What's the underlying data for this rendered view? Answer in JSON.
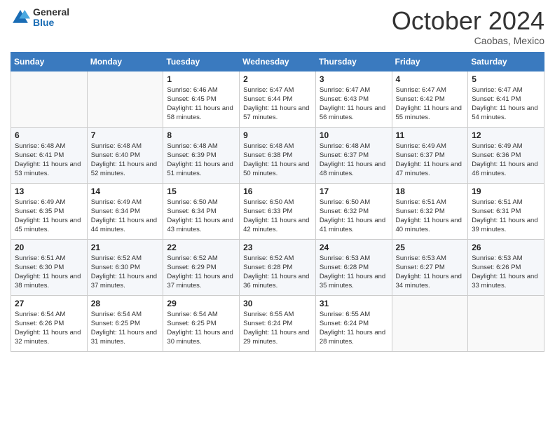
{
  "logo": {
    "general": "General",
    "blue": "Blue"
  },
  "title": "October 2024",
  "location": "Caobas, Mexico",
  "days_header": [
    "Sunday",
    "Monday",
    "Tuesday",
    "Wednesday",
    "Thursday",
    "Friday",
    "Saturday"
  ],
  "weeks": [
    [
      {
        "day": "",
        "content": ""
      },
      {
        "day": "",
        "content": ""
      },
      {
        "day": "1",
        "content": "Sunrise: 6:46 AM\nSunset: 6:45 PM\nDaylight: 11 hours and 58 minutes."
      },
      {
        "day": "2",
        "content": "Sunrise: 6:47 AM\nSunset: 6:44 PM\nDaylight: 11 hours and 57 minutes."
      },
      {
        "day": "3",
        "content": "Sunrise: 6:47 AM\nSunset: 6:43 PM\nDaylight: 11 hours and 56 minutes."
      },
      {
        "day": "4",
        "content": "Sunrise: 6:47 AM\nSunset: 6:42 PM\nDaylight: 11 hours and 55 minutes."
      },
      {
        "day": "5",
        "content": "Sunrise: 6:47 AM\nSunset: 6:41 PM\nDaylight: 11 hours and 54 minutes."
      }
    ],
    [
      {
        "day": "6",
        "content": "Sunrise: 6:48 AM\nSunset: 6:41 PM\nDaylight: 11 hours and 53 minutes."
      },
      {
        "day": "7",
        "content": "Sunrise: 6:48 AM\nSunset: 6:40 PM\nDaylight: 11 hours and 52 minutes."
      },
      {
        "day": "8",
        "content": "Sunrise: 6:48 AM\nSunset: 6:39 PM\nDaylight: 11 hours and 51 minutes."
      },
      {
        "day": "9",
        "content": "Sunrise: 6:48 AM\nSunset: 6:38 PM\nDaylight: 11 hours and 50 minutes."
      },
      {
        "day": "10",
        "content": "Sunrise: 6:48 AM\nSunset: 6:37 PM\nDaylight: 11 hours and 48 minutes."
      },
      {
        "day": "11",
        "content": "Sunrise: 6:49 AM\nSunset: 6:37 PM\nDaylight: 11 hours and 47 minutes."
      },
      {
        "day": "12",
        "content": "Sunrise: 6:49 AM\nSunset: 6:36 PM\nDaylight: 11 hours and 46 minutes."
      }
    ],
    [
      {
        "day": "13",
        "content": "Sunrise: 6:49 AM\nSunset: 6:35 PM\nDaylight: 11 hours and 45 minutes."
      },
      {
        "day": "14",
        "content": "Sunrise: 6:49 AM\nSunset: 6:34 PM\nDaylight: 11 hours and 44 minutes."
      },
      {
        "day": "15",
        "content": "Sunrise: 6:50 AM\nSunset: 6:34 PM\nDaylight: 11 hours and 43 minutes."
      },
      {
        "day": "16",
        "content": "Sunrise: 6:50 AM\nSunset: 6:33 PM\nDaylight: 11 hours and 42 minutes."
      },
      {
        "day": "17",
        "content": "Sunrise: 6:50 AM\nSunset: 6:32 PM\nDaylight: 11 hours and 41 minutes."
      },
      {
        "day": "18",
        "content": "Sunrise: 6:51 AM\nSunset: 6:32 PM\nDaylight: 11 hours and 40 minutes."
      },
      {
        "day": "19",
        "content": "Sunrise: 6:51 AM\nSunset: 6:31 PM\nDaylight: 11 hours and 39 minutes."
      }
    ],
    [
      {
        "day": "20",
        "content": "Sunrise: 6:51 AM\nSunset: 6:30 PM\nDaylight: 11 hours and 38 minutes."
      },
      {
        "day": "21",
        "content": "Sunrise: 6:52 AM\nSunset: 6:30 PM\nDaylight: 11 hours and 37 minutes."
      },
      {
        "day": "22",
        "content": "Sunrise: 6:52 AM\nSunset: 6:29 PM\nDaylight: 11 hours and 37 minutes."
      },
      {
        "day": "23",
        "content": "Sunrise: 6:52 AM\nSunset: 6:28 PM\nDaylight: 11 hours and 36 minutes."
      },
      {
        "day": "24",
        "content": "Sunrise: 6:53 AM\nSunset: 6:28 PM\nDaylight: 11 hours and 35 minutes."
      },
      {
        "day": "25",
        "content": "Sunrise: 6:53 AM\nSunset: 6:27 PM\nDaylight: 11 hours and 34 minutes."
      },
      {
        "day": "26",
        "content": "Sunrise: 6:53 AM\nSunset: 6:26 PM\nDaylight: 11 hours and 33 minutes."
      }
    ],
    [
      {
        "day": "27",
        "content": "Sunrise: 6:54 AM\nSunset: 6:26 PM\nDaylight: 11 hours and 32 minutes."
      },
      {
        "day": "28",
        "content": "Sunrise: 6:54 AM\nSunset: 6:25 PM\nDaylight: 11 hours and 31 minutes."
      },
      {
        "day": "29",
        "content": "Sunrise: 6:54 AM\nSunset: 6:25 PM\nDaylight: 11 hours and 30 minutes."
      },
      {
        "day": "30",
        "content": "Sunrise: 6:55 AM\nSunset: 6:24 PM\nDaylight: 11 hours and 29 minutes."
      },
      {
        "day": "31",
        "content": "Sunrise: 6:55 AM\nSunset: 6:24 PM\nDaylight: 11 hours and 28 minutes."
      },
      {
        "day": "",
        "content": ""
      },
      {
        "day": "",
        "content": ""
      }
    ]
  ]
}
